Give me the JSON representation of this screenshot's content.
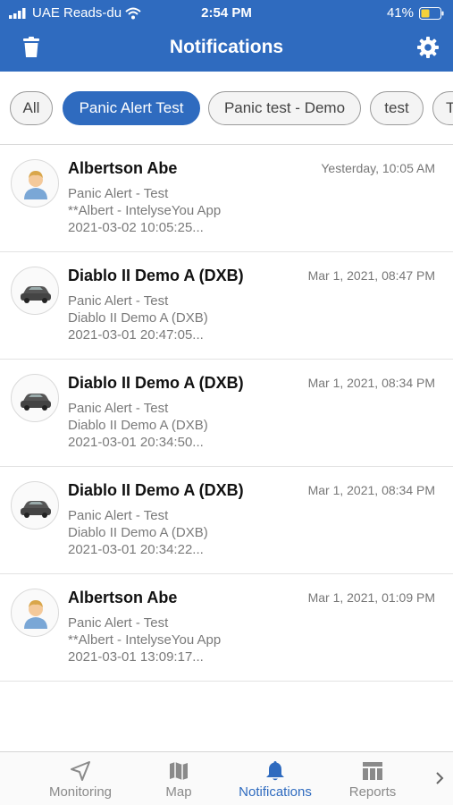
{
  "status_bar": {
    "carrier": "UAE Reads-du",
    "time": "2:54 PM",
    "battery": "41%"
  },
  "header": {
    "title": "Notifications",
    "trash_icon": "trash-icon",
    "settings_icon": "gear-icon"
  },
  "chips": [
    {
      "label": "All",
      "active": false
    },
    {
      "label": "Panic Alert Test",
      "active": true
    },
    {
      "label": "Panic test - Demo",
      "active": false
    },
    {
      "label": "test",
      "active": false
    },
    {
      "label": "T",
      "active": false
    }
  ],
  "notifications": [
    {
      "name": "Albertson Abe",
      "time": "Yesterday, 10:05 AM",
      "line1": "Panic Alert - Test",
      "line2": "**Albert - IntelyseYou App",
      "line3": "2021-03-02 10:05:25...",
      "avatar": "person-avatar-icon"
    },
    {
      "name": "Diablo II Demo A (DXB)",
      "time": "Mar 1, 2021, 08:47 PM",
      "line1": "Panic Alert - Test",
      "line2": "Diablo II Demo A (DXB)",
      "line3": "2021-03-01 20:47:05...",
      "avatar": "car-avatar-icon"
    },
    {
      "name": "Diablo II Demo A (DXB)",
      "time": "Mar 1, 2021, 08:34 PM",
      "line1": "Panic Alert - Test",
      "line2": "Diablo II Demo A (DXB)",
      "line3": "2021-03-01 20:34:50...",
      "avatar": "car-avatar-icon"
    },
    {
      "name": "Diablo II Demo A (DXB)",
      "time": "Mar 1, 2021, 08:34 PM",
      "line1": "Panic Alert - Test",
      "line2": "Diablo II Demo A (DXB)",
      "line3": "2021-03-01 20:34:22...",
      "avatar": "car-avatar-icon"
    },
    {
      "name": "Albertson Abe",
      "time": "Mar 1, 2021, 01:09 PM",
      "line1": "Panic Alert - Test",
      "line2": "**Albert - IntelyseYou App",
      "line3": "2021-03-01 13:09:17...",
      "avatar": "person-avatar-icon"
    }
  ],
  "tabs": [
    {
      "label": "Monitoring",
      "icon": "navigation-arrow-icon",
      "active": false
    },
    {
      "label": "Map",
      "icon": "map-icon",
      "active": false
    },
    {
      "label": "Notifications",
      "icon": "bell-icon",
      "active": true
    },
    {
      "label": "Reports",
      "icon": "reports-table-icon",
      "active": false
    }
  ],
  "colors": {
    "primary": "#2f6bbf",
    "inactive_tab": "#8a8a8a",
    "secondary_text": "#7a7a7a"
  }
}
